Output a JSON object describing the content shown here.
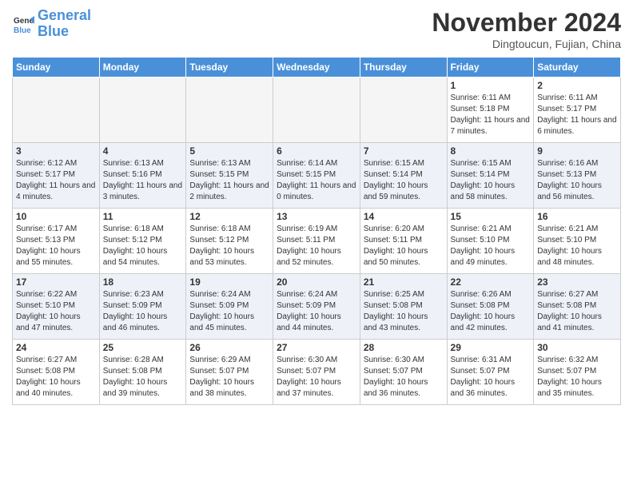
{
  "logo": {
    "text_general": "General",
    "text_blue": "Blue"
  },
  "header": {
    "month_year": "November 2024",
    "location": "Dingtoucun, Fujian, China"
  },
  "days_of_week": [
    "Sunday",
    "Monday",
    "Tuesday",
    "Wednesday",
    "Thursday",
    "Friday",
    "Saturday"
  ],
  "weeks": [
    [
      {
        "day": "",
        "empty": true
      },
      {
        "day": "",
        "empty": true
      },
      {
        "day": "",
        "empty": true
      },
      {
        "day": "",
        "empty": true
      },
      {
        "day": "",
        "empty": true
      },
      {
        "day": "1",
        "sunrise": "Sunrise: 6:11 AM",
        "sunset": "Sunset: 5:18 PM",
        "daylight": "Daylight: 11 hours and 7 minutes."
      },
      {
        "day": "2",
        "sunrise": "Sunrise: 6:11 AM",
        "sunset": "Sunset: 5:17 PM",
        "daylight": "Daylight: 11 hours and 6 minutes."
      }
    ],
    [
      {
        "day": "3",
        "sunrise": "Sunrise: 6:12 AM",
        "sunset": "Sunset: 5:17 PM",
        "daylight": "Daylight: 11 hours and 4 minutes."
      },
      {
        "day": "4",
        "sunrise": "Sunrise: 6:13 AM",
        "sunset": "Sunset: 5:16 PM",
        "daylight": "Daylight: 11 hours and 3 minutes."
      },
      {
        "day": "5",
        "sunrise": "Sunrise: 6:13 AM",
        "sunset": "Sunset: 5:15 PM",
        "daylight": "Daylight: 11 hours and 2 minutes."
      },
      {
        "day": "6",
        "sunrise": "Sunrise: 6:14 AM",
        "sunset": "Sunset: 5:15 PM",
        "daylight": "Daylight: 11 hours and 0 minutes."
      },
      {
        "day": "7",
        "sunrise": "Sunrise: 6:15 AM",
        "sunset": "Sunset: 5:14 PM",
        "daylight": "Daylight: 10 hours and 59 minutes."
      },
      {
        "day": "8",
        "sunrise": "Sunrise: 6:15 AM",
        "sunset": "Sunset: 5:14 PM",
        "daylight": "Daylight: 10 hours and 58 minutes."
      },
      {
        "day": "9",
        "sunrise": "Sunrise: 6:16 AM",
        "sunset": "Sunset: 5:13 PM",
        "daylight": "Daylight: 10 hours and 56 minutes."
      }
    ],
    [
      {
        "day": "10",
        "sunrise": "Sunrise: 6:17 AM",
        "sunset": "Sunset: 5:13 PM",
        "daylight": "Daylight: 10 hours and 55 minutes."
      },
      {
        "day": "11",
        "sunrise": "Sunrise: 6:18 AM",
        "sunset": "Sunset: 5:12 PM",
        "daylight": "Daylight: 10 hours and 54 minutes."
      },
      {
        "day": "12",
        "sunrise": "Sunrise: 6:18 AM",
        "sunset": "Sunset: 5:12 PM",
        "daylight": "Daylight: 10 hours and 53 minutes."
      },
      {
        "day": "13",
        "sunrise": "Sunrise: 6:19 AM",
        "sunset": "Sunset: 5:11 PM",
        "daylight": "Daylight: 10 hours and 52 minutes."
      },
      {
        "day": "14",
        "sunrise": "Sunrise: 6:20 AM",
        "sunset": "Sunset: 5:11 PM",
        "daylight": "Daylight: 10 hours and 50 minutes."
      },
      {
        "day": "15",
        "sunrise": "Sunrise: 6:21 AM",
        "sunset": "Sunset: 5:10 PM",
        "daylight": "Daylight: 10 hours and 49 minutes."
      },
      {
        "day": "16",
        "sunrise": "Sunrise: 6:21 AM",
        "sunset": "Sunset: 5:10 PM",
        "daylight": "Daylight: 10 hours and 48 minutes."
      }
    ],
    [
      {
        "day": "17",
        "sunrise": "Sunrise: 6:22 AM",
        "sunset": "Sunset: 5:10 PM",
        "daylight": "Daylight: 10 hours and 47 minutes."
      },
      {
        "day": "18",
        "sunrise": "Sunrise: 6:23 AM",
        "sunset": "Sunset: 5:09 PM",
        "daylight": "Daylight: 10 hours and 46 minutes."
      },
      {
        "day": "19",
        "sunrise": "Sunrise: 6:24 AM",
        "sunset": "Sunset: 5:09 PM",
        "daylight": "Daylight: 10 hours and 45 minutes."
      },
      {
        "day": "20",
        "sunrise": "Sunrise: 6:24 AM",
        "sunset": "Sunset: 5:09 PM",
        "daylight": "Daylight: 10 hours and 44 minutes."
      },
      {
        "day": "21",
        "sunrise": "Sunrise: 6:25 AM",
        "sunset": "Sunset: 5:08 PM",
        "daylight": "Daylight: 10 hours and 43 minutes."
      },
      {
        "day": "22",
        "sunrise": "Sunrise: 6:26 AM",
        "sunset": "Sunset: 5:08 PM",
        "daylight": "Daylight: 10 hours and 42 minutes."
      },
      {
        "day": "23",
        "sunrise": "Sunrise: 6:27 AM",
        "sunset": "Sunset: 5:08 PM",
        "daylight": "Daylight: 10 hours and 41 minutes."
      }
    ],
    [
      {
        "day": "24",
        "sunrise": "Sunrise: 6:27 AM",
        "sunset": "Sunset: 5:08 PM",
        "daylight": "Daylight: 10 hours and 40 minutes."
      },
      {
        "day": "25",
        "sunrise": "Sunrise: 6:28 AM",
        "sunset": "Sunset: 5:08 PM",
        "daylight": "Daylight: 10 hours and 39 minutes."
      },
      {
        "day": "26",
        "sunrise": "Sunrise: 6:29 AM",
        "sunset": "Sunset: 5:07 PM",
        "daylight": "Daylight: 10 hours and 38 minutes."
      },
      {
        "day": "27",
        "sunrise": "Sunrise: 6:30 AM",
        "sunset": "Sunset: 5:07 PM",
        "daylight": "Daylight: 10 hours and 37 minutes."
      },
      {
        "day": "28",
        "sunrise": "Sunrise: 6:30 AM",
        "sunset": "Sunset: 5:07 PM",
        "daylight": "Daylight: 10 hours and 36 minutes."
      },
      {
        "day": "29",
        "sunrise": "Sunrise: 6:31 AM",
        "sunset": "Sunset: 5:07 PM",
        "daylight": "Daylight: 10 hours and 36 minutes."
      },
      {
        "day": "30",
        "sunrise": "Sunrise: 6:32 AM",
        "sunset": "Sunset: 5:07 PM",
        "daylight": "Daylight: 10 hours and 35 minutes."
      }
    ]
  ]
}
